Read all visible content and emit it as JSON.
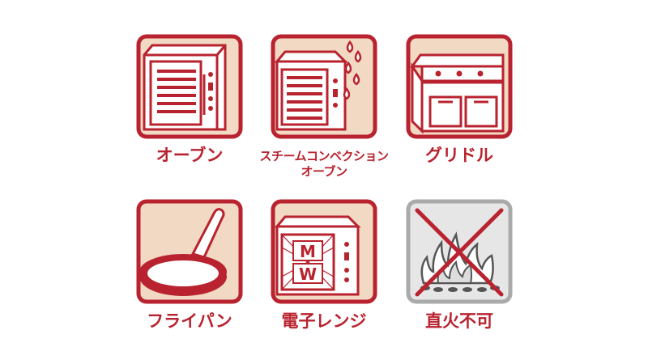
{
  "colors": {
    "red": "#b8232f",
    "beige": "#f2d9c4",
    "gray": "#aaaaaa",
    "gray_bg": "#e6e6e6"
  },
  "icons": [
    {
      "name": "oven-icon",
      "label": "オーブン",
      "label_line2": ""
    },
    {
      "name": "steam-convection-oven-icon",
      "label": "スチームコンベクション",
      "label_line2": "オーブン"
    },
    {
      "name": "griddle-icon",
      "label": "グリドル",
      "label_line2": ""
    },
    {
      "name": "frying-pan-icon",
      "label": "フライパン",
      "label_line2": ""
    },
    {
      "name": "microwave-icon",
      "label": "電子レンジ",
      "label_line2": ""
    },
    {
      "name": "no-direct-fire-icon",
      "label": "直火不可",
      "label_line2": ""
    }
  ],
  "microwave_text": {
    "top": "M",
    "bottom": "W"
  }
}
